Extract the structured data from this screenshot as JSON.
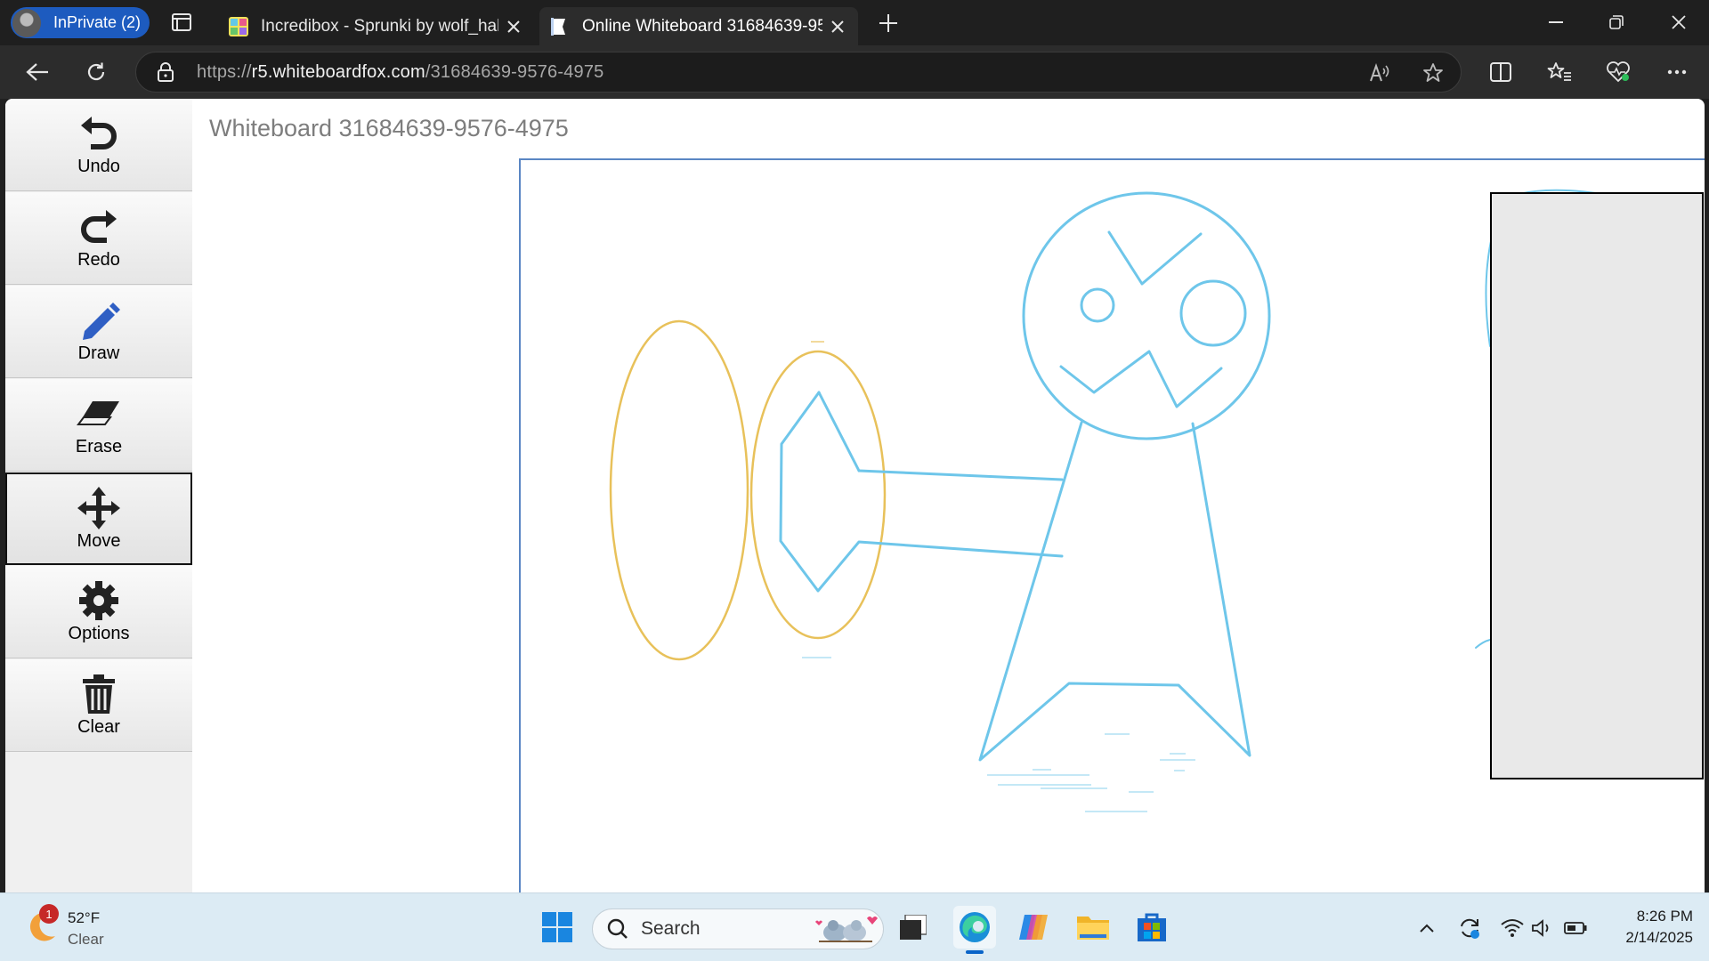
{
  "browser": {
    "inprivate_label": "InPrivate (2)",
    "tabs": [
      {
        "title": "Incredibox - Sprunki by wolf_hal",
        "active": false
      },
      {
        "title": "Online Whiteboard 31684639-9576-4975",
        "active": true
      }
    ],
    "url_scheme": "https://",
    "url_host": "r5.whiteboardfox.com",
    "url_path": "/31684639-9576-4975"
  },
  "whiteboard": {
    "title": "Whiteboard 31684639-9576-4975",
    "tools": [
      {
        "label": "Undo",
        "icon": "undo-icon"
      },
      {
        "label": "Redo",
        "icon": "redo-icon"
      },
      {
        "label": "Draw",
        "icon": "pencil-icon"
      },
      {
        "label": "Erase",
        "icon": "eraser-icon"
      },
      {
        "label": "Move",
        "icon": "move-icon",
        "selected": true
      },
      {
        "label": "Options",
        "icon": "gear-icon"
      },
      {
        "label": "Clear",
        "icon": "trash-icon"
      }
    ],
    "colors": {
      "stroke_blue": "#6ec6ea",
      "stroke_yellow": "#e8c15a",
      "frame": "#5a86c4"
    }
  },
  "taskbar": {
    "weather_temp": "52°F",
    "weather_cond": "Clear",
    "weather_badge": "1",
    "search_placeholder": "Search",
    "time": "8:26 PM",
    "date": "2/14/2025"
  }
}
